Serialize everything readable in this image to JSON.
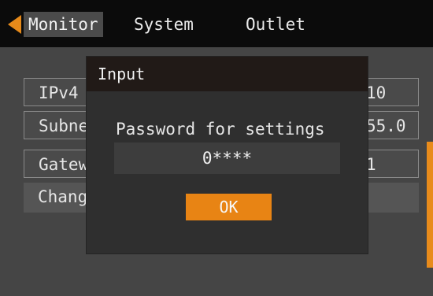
{
  "menu": {
    "tabs": [
      {
        "label": "Monitor"
      },
      {
        "label": "System"
      },
      {
        "label": "Outlet"
      }
    ],
    "active_tab": "Monitor",
    "back_icon": "back-arrow-icon"
  },
  "network_table": {
    "rows": [
      {
        "label": "IPv4",
        "value": "10"
      },
      {
        "label": "Subne",
        "value": "55.0"
      },
      {
        "label": "Gatew",
        "value": "1"
      },
      {
        "label": "Chang",
        "value": ""
      }
    ]
  },
  "dialog": {
    "title": "Input",
    "prompt": "Password for settings",
    "password_value": "0****",
    "ok_label": "OK"
  },
  "colors": {
    "accent": "#e88414",
    "background": "#454545",
    "menubar": "#0b0b0b",
    "dialog_body": "#2f2f2f",
    "dialog_header": "#211a17"
  }
}
